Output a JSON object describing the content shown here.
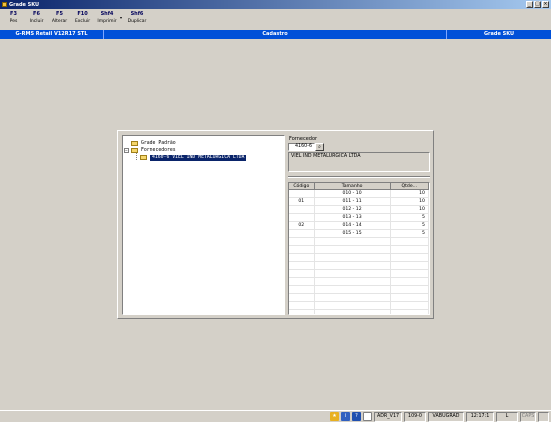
{
  "window": {
    "title": "Grade SKU",
    "controls": [
      "_",
      "□",
      "×"
    ]
  },
  "toolbar": {
    "buttons": [
      {
        "key": "F3",
        "label": "Pes"
      },
      {
        "key": "F6",
        "label": "Incluir"
      },
      {
        "key": "F5",
        "label": "Alterar"
      },
      {
        "key": "F10",
        "label": "Excluir"
      },
      {
        "key": "Shf4",
        "label": "Imprimir"
      },
      {
        "key": "Shf6",
        "label": "Duplicar"
      }
    ],
    "dropdown_glyph": "▾"
  },
  "header": {
    "left": "G-RMS Retail V12R17 STL",
    "center": "Cadastro",
    "right": "Grade SKU"
  },
  "tree": {
    "root": "Grade Padrão",
    "group": "Fornecedores",
    "expander": "−",
    "selected": "4160-6 VIEL IND METALURGICA LTDA"
  },
  "supplier": {
    "label": "Fornecedor",
    "code": "4160-6",
    "search_icon": "binoculars-icon",
    "search_glyph": "⌕",
    "name": "VIEL IND METALURGICA LTDA"
  },
  "grid": {
    "columns": [
      "Código",
      "Tamanho",
      "Qtde..."
    ],
    "rows": [
      {
        "code": "",
        "size": "010 - 10",
        "qty": "10"
      },
      {
        "code": "01",
        "size": "011 - 11",
        "qty": "10"
      },
      {
        "code": "",
        "size": "012 - 12",
        "qty": "10"
      },
      {
        "code": "",
        "size": "013 - 13",
        "qty": "5"
      },
      {
        "code": "02",
        "size": "014 - 14",
        "qty": "5"
      },
      {
        "code": "",
        "size": "015 - 15",
        "qty": "5"
      }
    ]
  },
  "statusbar": {
    "user": "ADR_V17",
    "branch": "109-0",
    "station": "VABUGRAD",
    "time": "12:17:1",
    "mode": "L",
    "caps": "CAPS"
  }
}
